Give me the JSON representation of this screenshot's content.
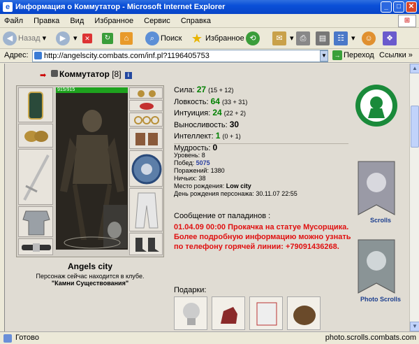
{
  "window": {
    "title": "Информация о Коммутатор - Microsoft Internet Explorer"
  },
  "menu": [
    "Файл",
    "Правка",
    "Вид",
    "Избранное",
    "Сервис",
    "Справка"
  ],
  "toolbar": {
    "back": "Назад",
    "search": "Поиск",
    "favorites": "Избранное"
  },
  "address": {
    "label": "Адрес:",
    "url": "http://angelscity.combats.com/inf.pl?1196405753",
    "go": "Переход",
    "links": "Ссылки"
  },
  "status": {
    "text": "Готово",
    "url": "photo.scrolls.combats.com"
  },
  "character": {
    "name": "Коммутатор",
    "level": "[8]",
    "hp": "915/915",
    "stats": [
      {
        "label": "Сила:",
        "value": "27",
        "detail": "(15 + 12)"
      },
      {
        "label": "Ловкость:",
        "value": "64",
        "detail": "(33 + 31)"
      },
      {
        "label": "Интуиция:",
        "value": "24",
        "detail": "(22 + 2)"
      },
      {
        "label": "Выносливость:",
        "value": "30",
        "detail": ""
      },
      {
        "label": "Интеллект:",
        "value": "1",
        "detail": "(0 + 1)"
      },
      {
        "label": "Мудрость:",
        "value": "0",
        "detail": ""
      }
    ],
    "info": {
      "level_label": "Уровень:",
      "level_value": "8",
      "wins_label": "Побед:",
      "wins_value": "5075",
      "losses_label": "Поражений:",
      "losses_value": "1380",
      "draws_label": "Ничьих:",
      "draws_value": "38",
      "birthplace_label": "Место рождения:",
      "birthplace_value": "Low city",
      "birthday_label": "День рождения персонажа:",
      "birthday_value": "30.11.07 22:55"
    },
    "location": {
      "city": "Angels city",
      "status": "Персонаж сейчас находится в клубе.",
      "place": "\"Камни Существования\""
    }
  },
  "paladin": {
    "header": "Сообщение от паладинов :",
    "message": "01.04.09 00:00 Прокачка на статуе Мусорщика. Более подробную информацию можно узнать по телефону горячей линии: +79091436268."
  },
  "gifts": {
    "header": "Подарки:"
  },
  "sidebar": {
    "scrolls": "Scrolls",
    "photo": "Photo Scrolls"
  },
  "colors": {
    "accent_red": "#e01010",
    "stat_green": "#008000",
    "link_blue": "#1b3e8e"
  }
}
